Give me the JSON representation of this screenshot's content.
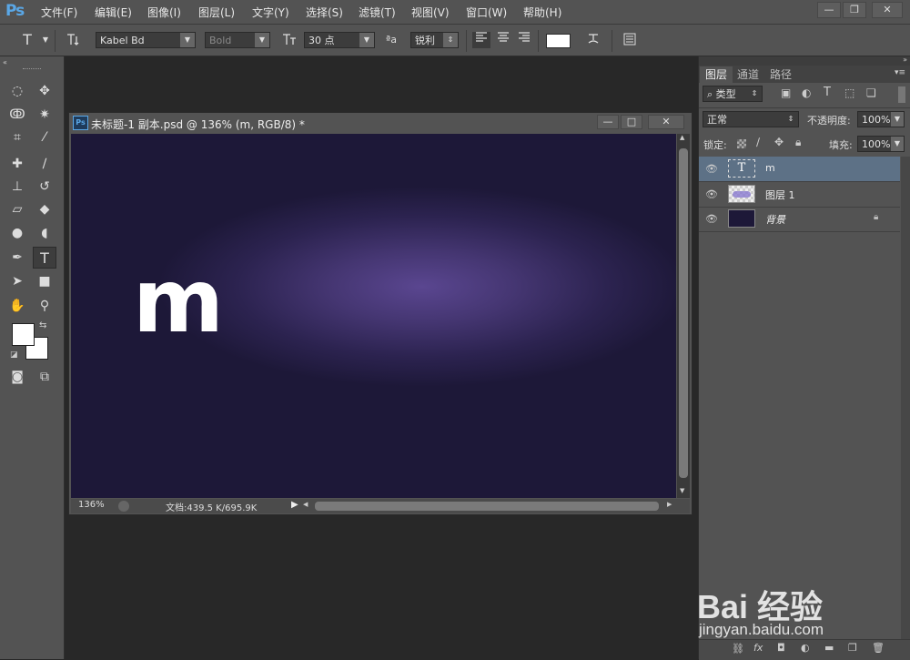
{
  "app": {
    "logo": "Ps"
  },
  "menu": [
    "文件(F)",
    "编辑(E)",
    "图像(I)",
    "图层(L)",
    "文字(Y)",
    "选择(S)",
    "滤镜(T)",
    "视图(V)",
    "窗口(W)",
    "帮助(H)"
  ],
  "window_controls": {
    "minimize": "—",
    "restore": "❐",
    "close": "✕"
  },
  "options": {
    "tool_glyph": "T",
    "font_family": "Kabel Bd",
    "font_style": "Bold",
    "font_size": "30 点",
    "aa_label": "ªa",
    "antialias": "锐利"
  },
  "document": {
    "title": "未标题-1 副本.psd @ 136% (m, RGB/8) *",
    "canvas_text": "m",
    "zoom": "136%",
    "doc_info": "文档:439.5 K/695.9K"
  },
  "panel": {
    "tabs": [
      "图层",
      "通道",
      "路径"
    ],
    "filter_kind": "类型",
    "blend_mode": "正常",
    "opacity_label": "不透明度:",
    "opacity_value": "100%",
    "lock_label": "锁定:",
    "fill_label": "填充:",
    "fill_value": "100%",
    "layers": [
      {
        "name": "m",
        "kind": "text",
        "selected": true
      },
      {
        "name": "图层 1",
        "kind": "pixel",
        "selected": false
      },
      {
        "name": "背景",
        "kind": "background",
        "selected": false,
        "locked": true
      }
    ]
  },
  "watermark": {
    "brand": "Bai 经验",
    "url": "jingyan.baidu.com"
  },
  "colors": {
    "canvas_glow": "#5a4690",
    "canvas_dark": "#1d1838",
    "ui_gray": "#535353",
    "logo_blue": "#5aa7e6"
  }
}
